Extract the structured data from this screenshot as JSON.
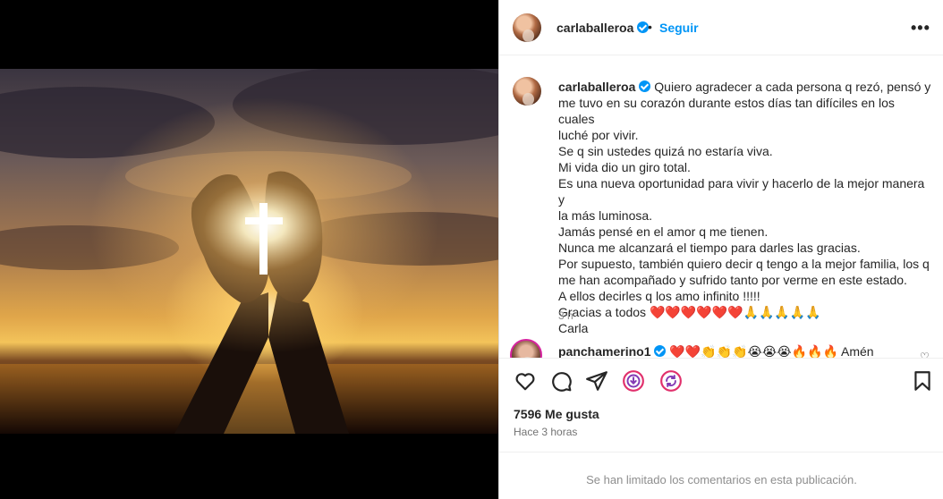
{
  "post": {
    "username": "carlaballeroa",
    "follow_label": "Seguir",
    "separator": "•",
    "more_label": "•••"
  },
  "caption": {
    "username": "carlaballeroa",
    "lines": [
      "Quiero agradecer a cada persona q rezó, pensó y",
      "me tuvo en su corazón durante estos días tan difíciles en los cuales",
      "luché por vivir.",
      "Se q sin ustedes quizá no estaría viva.",
      "Mi vida dio un giro total.",
      "Es una nueva oportunidad para vivir y hacerlo de la mejor manera y",
      "la más luminosa.",
      "Jamás pensé en el amor q me tienen.",
      "Nunca me alcanzará el tiempo para darles las gracias.",
      "Por supuesto, también quiero decir q tengo a la mejor familia, los q",
      "me han acompañado y sufrido tanto por verme en este estado.",
      "A ellos decirles q los amo infinito !!!!!",
      "Gracias a todos ❤️❤️❤️❤️❤️❤️🙏🙏🙏🙏🙏",
      "Carla"
    ],
    "time": "3 h"
  },
  "comments": [
    {
      "username": "panchamerino1",
      "text": "❤️❤️👏👏👏😭😭😭🔥🔥🔥 Amén",
      "like_icon": "heart-outline-icon"
    }
  ],
  "actions": {
    "icons": [
      "heart-icon",
      "comment-icon",
      "share-icon",
      "reels-icon",
      "remix-icon",
      "bookmark-icon"
    ]
  },
  "likes_text": "7596 Me gusta",
  "posted_text": "Hace 3 horas",
  "comments_limited": "Se han limitado los comentarios en esta publicación.",
  "colors": {
    "accent": "#0095f6",
    "text": "#262626",
    "muted": "#8e8e8e",
    "story_ring": "#d6249f"
  }
}
